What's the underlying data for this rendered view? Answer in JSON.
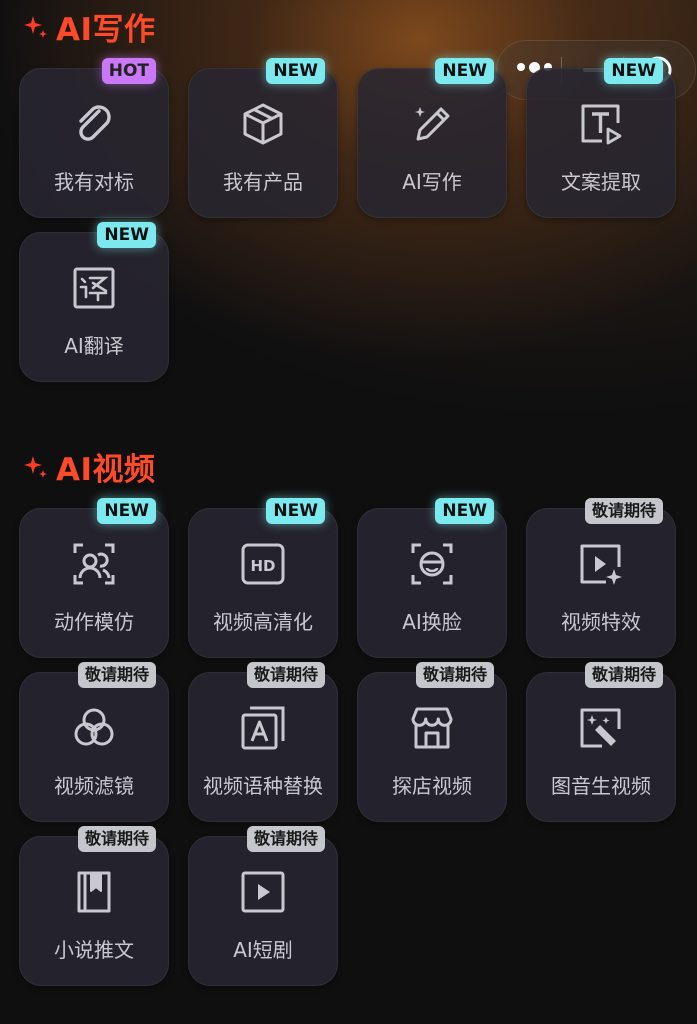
{
  "capsule": {
    "more_icon": "more-dots-icon",
    "minimize_icon": "minimize-icon",
    "close_icon": "target-close-icon"
  },
  "sections": {
    "writing": {
      "title": "AI写作",
      "items": [
        {
          "label": "我有对标",
          "badge": "HOT",
          "icon": "paperclip-icon"
        },
        {
          "label": "我有产品",
          "badge": "NEW",
          "icon": "box-icon"
        },
        {
          "label": "AI写作",
          "badge": "NEW",
          "icon": "magic-pen-icon"
        },
        {
          "label": "文案提取",
          "badge": "NEW",
          "icon": "text-extract-icon"
        },
        {
          "label": "AI翻译",
          "badge": "NEW",
          "icon": "translate-icon"
        }
      ]
    },
    "video": {
      "title": "AI视频",
      "items": [
        {
          "label": "动作模仿",
          "badge": "NEW",
          "icon": "person-scan-icon"
        },
        {
          "label": "视频高清化",
          "badge": "NEW",
          "icon": "hd-icon"
        },
        {
          "label": "AI换脸",
          "badge": "NEW",
          "icon": "face-scan-icon"
        },
        {
          "label": "视频特效",
          "badge": "敬请期待",
          "icon": "video-sparkle-icon"
        },
        {
          "label": "视频滤镜",
          "badge": "敬请期待",
          "icon": "filter-circles-icon"
        },
        {
          "label": "视频语种替换",
          "badge": "敬请期待",
          "icon": "language-a-icon"
        },
        {
          "label": "探店视频",
          "badge": "敬请期待",
          "icon": "storefront-icon"
        },
        {
          "label": "图音生视频",
          "badge": "敬请期待",
          "icon": "image-magic-icon"
        },
        {
          "label": "小说推文",
          "badge": "敬请期待",
          "icon": "book-icon"
        },
        {
          "label": "AI短剧",
          "badge": "敬请期待",
          "icon": "play-frame-icon"
        }
      ]
    }
  },
  "colors": {
    "title": "#ff4a2a",
    "badge_new": "#7ce9ef",
    "badge_hot": "#c978f7",
    "badge_soon": "#c4c6cc",
    "card_bg": "#28263000"
  }
}
